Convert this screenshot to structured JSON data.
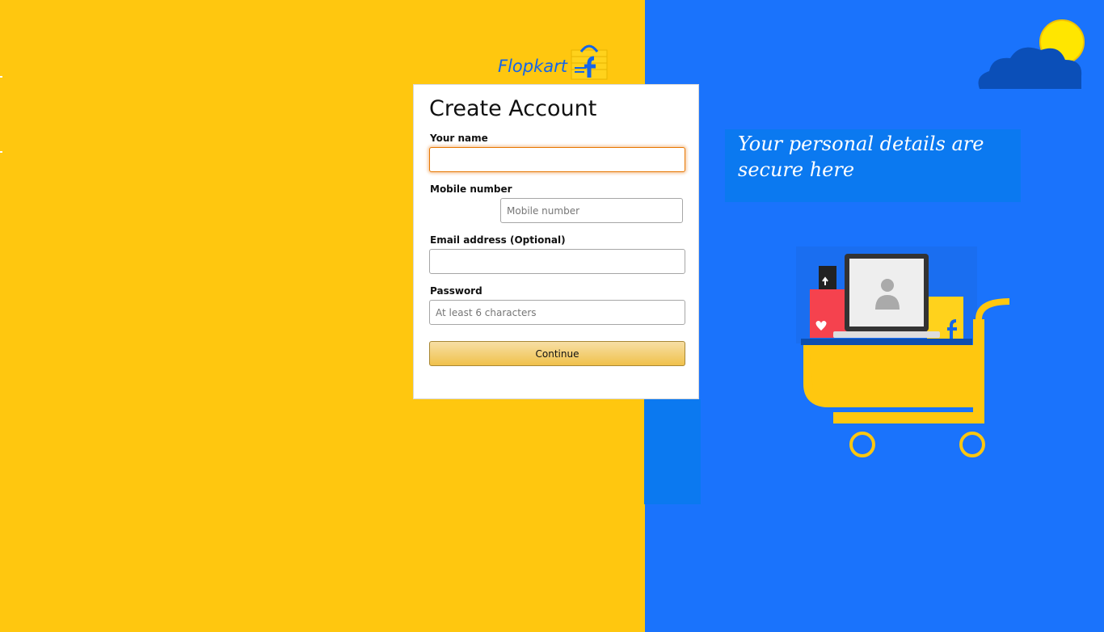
{
  "brand": {
    "name": "Flopkart",
    "logo_icon": "shopping-bag-logo-icon"
  },
  "form": {
    "title": "Create Account",
    "name_label": "Your name",
    "name_value": "",
    "mobile_label": "Mobile number",
    "mobile_placeholder": "Mobile number",
    "email_label": "Email address (Optional)",
    "email_value": "",
    "password_label": "Password",
    "password_placeholder": "At least 6 characters",
    "continue_label": "Continue"
  },
  "side": {
    "message": "Your  personal  details are secure  here",
    "weather_icon": "sun-cloud-icon",
    "illustration_icon": "shopping-cart-laptop-icon"
  },
  "colors": {
    "left_bg": "#ffc70f",
    "right_bg": "#1a73fc",
    "button": "#f0c14b",
    "focus": "#e77600"
  }
}
